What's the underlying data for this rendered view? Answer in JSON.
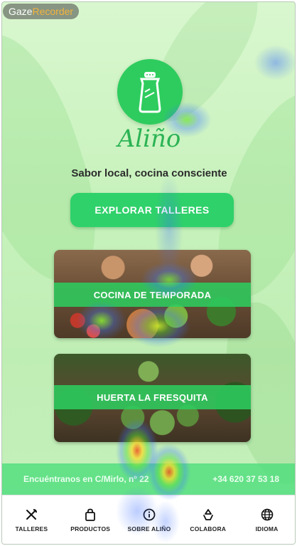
{
  "recorder": {
    "part1": "Gaze",
    "part2": "Recorder"
  },
  "brand": {
    "name": "Aliño",
    "tagline": "Sabor local, cocina consciente"
  },
  "hero_button": {
    "label": "EXPLORAR TALLERES"
  },
  "cards": [
    {
      "title": "COCINA DE TEMPORADA"
    },
    {
      "title": "HUERTA LA FRESQUITA"
    }
  ],
  "contact": {
    "address": "Encuéntranos en C/Mirlo, nº 22",
    "phone": "+34 620 37 53 18"
  },
  "nav": [
    {
      "label": "TALLERES",
      "icon": "utensils-icon"
    },
    {
      "label": "PRODUCTOS",
      "icon": "shopping-bag-icon"
    },
    {
      "label": "SOBRE ALIÑO",
      "icon": "info-icon"
    },
    {
      "label": "COLABORA",
      "icon": "recycle-icon"
    },
    {
      "label": "IDIOMA",
      "icon": "globe-icon"
    }
  ],
  "colors": {
    "accent": "#2ecc5e",
    "button": "#2fd16a",
    "brand_text": "#2bb354"
  }
}
